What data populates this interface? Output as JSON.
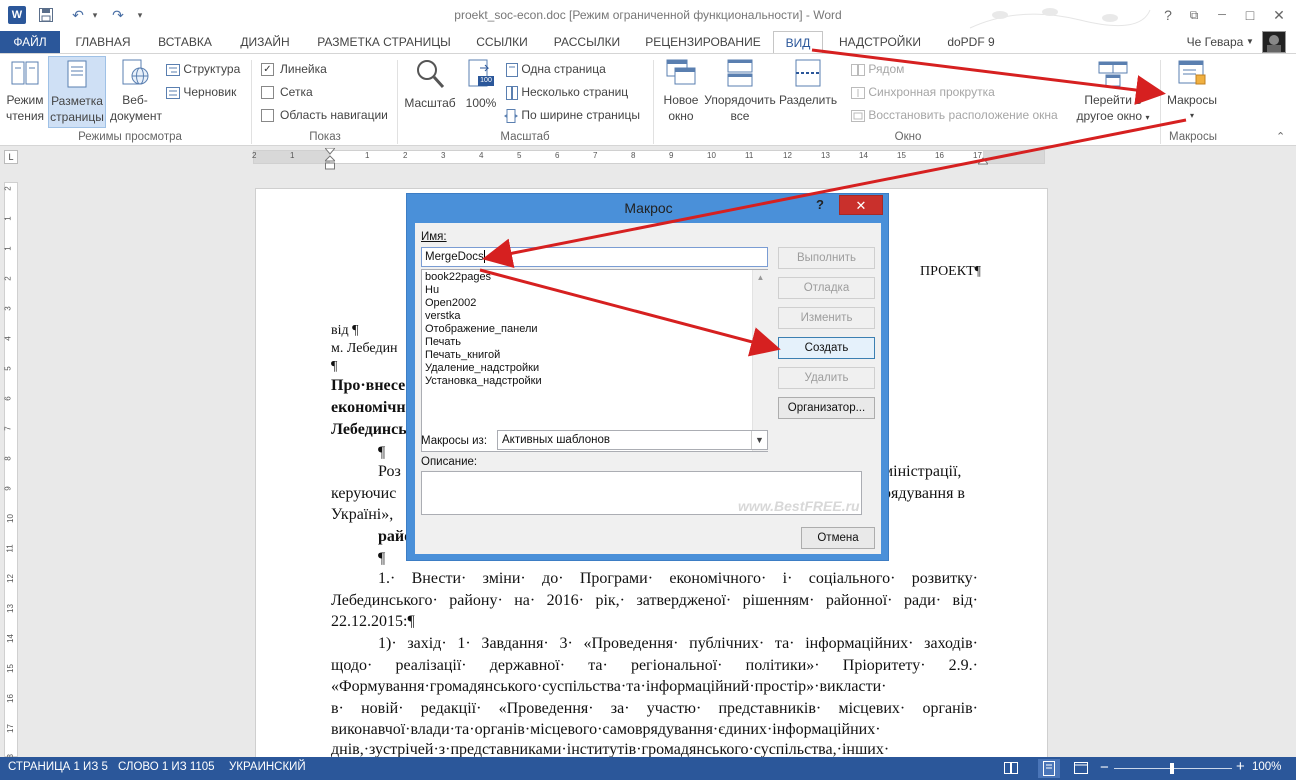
{
  "window": {
    "title": "proekt_soc-econ.doc [Режим ограниченной функциональности] - Word",
    "user": "Че Гевара",
    "controls": {
      "help": "?",
      "restore": "⧉",
      "minimize": "─",
      "maximize": "□",
      "close": "✕"
    }
  },
  "quick_access": {
    "save_icon": "save-icon",
    "undo_icon": "undo-icon",
    "redo_icon": "redo-icon",
    "more": "▾"
  },
  "tabs": [
    {
      "label": "ФАЙЛ"
    },
    {
      "label": "ГЛАВНАЯ"
    },
    {
      "label": "ВСТАВКА"
    },
    {
      "label": "ДИЗАЙН"
    },
    {
      "label": "РАЗМЕТКА СТРАНИЦЫ"
    },
    {
      "label": "ССЫЛКИ"
    },
    {
      "label": "РАССЫЛКИ"
    },
    {
      "label": "РЕЦЕНЗИРОВАНИЕ"
    },
    {
      "label": "ВИД"
    },
    {
      "label": "НАДСТРОЙКИ"
    },
    {
      "label": "doPDF 9"
    }
  ],
  "active_tab": "ВИД",
  "ribbon": {
    "views": {
      "group": "Режимы просмотра",
      "read_mode": [
        "Режим",
        "чтения"
      ],
      "print_layout": [
        "Разметка",
        "страницы"
      ],
      "web_layout": [
        "Веб-",
        "документ"
      ],
      "outline": "Структура",
      "draft": "Черновик"
    },
    "show": {
      "group": "Показ",
      "ruler": "Линейка",
      "gridlines": "Сетка",
      "nav_pane": "Область навигации",
      "ruler_checked": "✓"
    },
    "zoom": {
      "group": "Масштаб",
      "zoom": "Масштаб",
      "hundred": "100%",
      "hundred_icon_text": "100",
      "one_page": "Одна страница",
      "multiple_pages": "Несколько страниц",
      "page_width": "По ширине страницы"
    },
    "window": {
      "group": "Окно",
      "new_window": [
        "Новое",
        "окно"
      ],
      "arrange_all": [
        "Упорядочить",
        "все"
      ],
      "split": "Разделить",
      "side_by_side": "Рядом",
      "sync_scroll": "Синхронная прокрутка",
      "reset_position": "Восстановить расположение окна",
      "switch_windows": [
        "Перейти в",
        "другое окно"
      ]
    },
    "macros": {
      "group": "Макросы",
      "button": "Макросы"
    }
  },
  "ruler": {
    "ticks": [
      "2",
      "1",
      "1",
      "2",
      "3",
      "4",
      "5",
      "6",
      "7",
      "8",
      "9",
      "10",
      "11",
      "12",
      "13",
      "14",
      "15",
      "16",
      "17"
    ],
    "vticks": [
      "2",
      "1",
      "1",
      "2",
      "3",
      "4",
      "5",
      "6",
      "7",
      "8",
      "9",
      "10",
      "11",
      "12",
      "13",
      "14",
      "15",
      "16",
      "17",
      "18"
    ],
    "corner": "L"
  },
  "document": {
    "header_right": "ПРОЕКТ¶",
    "lines": [
      "від ¶",
      "м. Лебедин",
      "¶",
      "Про·внесе",
      "економічн",
      "Лебединсь",
      "¶",
      "Роз",
      "керуючис",
      "Україні»,",
      "райо",
      "¶"
    ],
    "right_fragments": [
      "міністрації,",
      "рядування   в"
    ],
    "paragraph_1": [
      "1.· Внести· зміни· до· Програми· економічного· і· соціального· розвитку·",
      "Лебединського· району· на· 2016· рік,· затвердженої· рішенням· районної· ради· від·",
      "22.12.2015:¶"
    ],
    "paragraph_2": [
      "1)· захід· 1· Завдання· 3· «Проведення· публічних· та· інформаційних· заходів·",
      "щодо·  реалізації·  державної·  та·  регіональної·  політики»·  Пріоритету·  2.9.·",
      "«Формування·громадянського·суспільства·та·інформаційний·простір»·викласти·",
      "в·  новій·  редакції·  «Проведення·  за·  участю·  представників·  місцевих·  органів·",
      "виконавчої·влади·та·органів·місцевого·самоврядування·єдиних·інформаційних·",
      "днів,·зустрічей·з·представниками·інститутів·громадянського·суспільства,·інших·"
    ]
  },
  "dialog": {
    "title": "Макрос",
    "help": "?",
    "close": "✕",
    "name_label": "Имя:",
    "name_value": "MergeDocs",
    "macros": [
      "book22pages",
      "Hu",
      "Open2002",
      "verstka",
      "Отображение_панели",
      "Печать",
      "Печать_книгой",
      "Удаление_надстройки",
      "Установка_надстройки"
    ],
    "buttons": {
      "run": "Выполнить",
      "step_into": "Отладка",
      "edit": "Изменить",
      "create": "Создать",
      "delete": "Удалить",
      "organizer": "Организатор...",
      "cancel": "Отмена"
    },
    "macros_in_label": "Макросы из:",
    "macros_in_value": "Активных шаблонов",
    "description_label": "Описание:",
    "watermark": "www.BestFREE.ru"
  },
  "status": {
    "page": "СТРАНИЦА 1 ИЗ 5",
    "words": "СЛОВО 1 ИЗ 1105",
    "language": "УКРАИНСКИЙ",
    "zoom_minus": "−",
    "zoom_plus": "+",
    "zoom_level": "100%"
  },
  "colors": {
    "accent": "#2b579a",
    "dialog_frame": "#4a90d9",
    "close_red": "#c9302c",
    "arrow_red": "#d62020"
  }
}
